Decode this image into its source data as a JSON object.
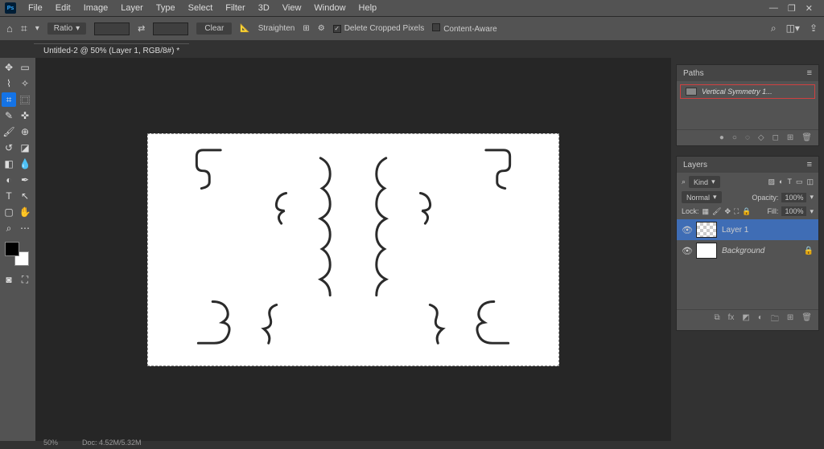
{
  "menubar": {
    "items": [
      "File",
      "Edit",
      "Image",
      "Layer",
      "Type",
      "Select",
      "Filter",
      "3D",
      "View",
      "Window",
      "Help"
    ]
  },
  "optionsbar": {
    "ratio_label": "Ratio",
    "clear_label": "Clear",
    "straighten_label": "Straighten",
    "delete_cropped_label": "Delete Cropped Pixels",
    "delete_cropped_checked": true,
    "content_aware_label": "Content-Aware",
    "content_aware_checked": false
  },
  "document_tab": "Untitled-2 @ 50% (Layer 1, RGB/8#) *",
  "paths_panel": {
    "title": "Paths",
    "items": [
      "Vertical Symmetry 1..."
    ]
  },
  "layers_panel": {
    "title": "Layers",
    "kind_label": "Kind",
    "blend_mode": "Normal",
    "opacity_label": "Opacity:",
    "opacity_value": "100%",
    "lock_label": "Lock:",
    "fill_label": "Fill:",
    "fill_value": "100%",
    "layers": [
      {
        "name": "Layer 1",
        "visible": true,
        "active": true,
        "locked": false,
        "background": false
      },
      {
        "name": "Background",
        "visible": true,
        "active": false,
        "locked": true,
        "background": true
      }
    ]
  },
  "statusbar": {
    "zoom": "50%",
    "doc": "Doc: 4.52M/5.32M"
  }
}
